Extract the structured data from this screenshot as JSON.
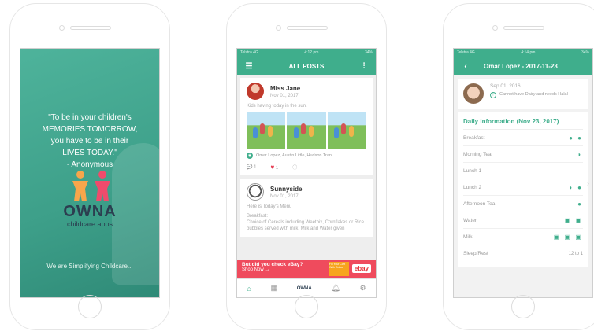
{
  "splash": {
    "quote_line1": "\"To be in your children's",
    "quote_line2": "MEMORIES TOMORROW,",
    "quote_line3": "you have to be in their",
    "quote_line4": "LIVES TODAY.\"",
    "quote_author": "- Anonymous",
    "brand": "OWNA",
    "brand_sub": "childcare apps",
    "tagline": "We are Simplifying Childcare..."
  },
  "feed": {
    "status_left": "Telstra 4G",
    "status_time": "4:12 pm",
    "status_right": "34%",
    "header_title": "ALL POSTS",
    "posts": [
      {
        "name": "Miss Jane",
        "date": "Nov 01, 2017",
        "text": "Kids having today in the sun.",
        "tagged": "Omar Lopez, Austin Little, Hudson Tran",
        "comments": "1",
        "likes": "1"
      },
      {
        "name": "Sunnyside",
        "date": "Nov 01, 2017",
        "text": "Here is Today's Menu",
        "body1": "Breakfast:",
        "body2": "Choice of Cereals including Weetbix, Cornflakes or Rice bubbles served with milk. Milk and Water given"
      }
    ],
    "ad_title": "But did you check eBay?",
    "ad_sub": "Shop Now →",
    "ad_note": "Fill Your Cart With Colour",
    "ad_brand": "ebay",
    "tab_logo": "OWNA"
  },
  "daily": {
    "status_left": "Telstra 4G",
    "status_time": "4:14 pm",
    "status_right": "34%",
    "header_title": "Omar Lopez - 2017-11-23",
    "dob": "Sep 01, 2016",
    "alert": "Cannot have Dairy and needs Halal",
    "section_title": "Daily Information (Nov 23, 2017)",
    "rows": [
      {
        "label": "Breakfast",
        "marks": "● ●"
      },
      {
        "label": "Morning Tea",
        "marks": "◗"
      },
      {
        "label": "Lunch 1",
        "marks": ""
      },
      {
        "label": "Lunch 2",
        "marks": "◗ ●"
      },
      {
        "label": "Afternoon Tea",
        "marks": "●"
      },
      {
        "label": "Water",
        "marks": "▣ ▣"
      },
      {
        "label": "Milk",
        "marks": "▣ ▣ ▣"
      },
      {
        "label": "Sleep/Rest",
        "marks": "12 to 1"
      }
    ]
  }
}
